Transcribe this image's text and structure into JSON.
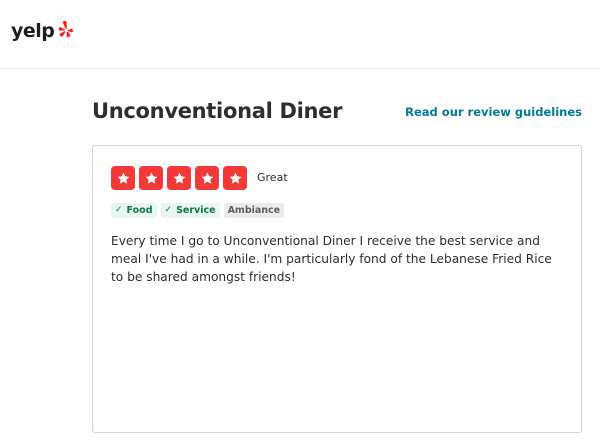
{
  "header": {
    "logo_text": "yelp",
    "logo_color": "#ff1a1a"
  },
  "page": {
    "title": "Unconventional Diner",
    "guidelines_link": "Read our review guidelines",
    "link_color": "#027a97"
  },
  "review": {
    "rating": 5,
    "max_rating": 5,
    "rating_label": "Great",
    "star_color": "#f43939",
    "tags": [
      {
        "label": "Food",
        "selected": true,
        "icon": "check-icon"
      },
      {
        "label": "Service",
        "selected": true,
        "icon": "check-icon"
      },
      {
        "label": "Ambiance",
        "selected": false
      }
    ],
    "text": "Every time I go to Unconventional Diner I receive the best service and meal I've had in a while. I'm particularly fond of the Lebanese Fried Rice to be shared amongst friends!"
  }
}
